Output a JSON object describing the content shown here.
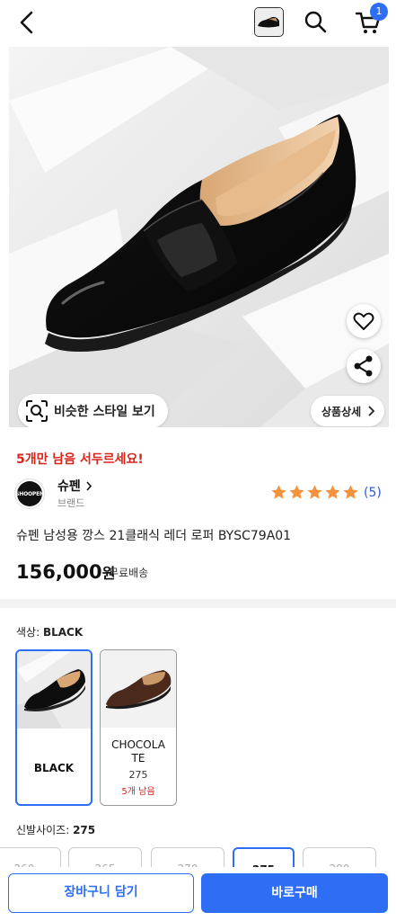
{
  "header": {
    "back_icon": "back-arrow-icon",
    "search_icon": "search-icon",
    "cart_icon": "cart-icon",
    "cart_count": "1"
  },
  "hero": {
    "similar_style_label": "비슷한 스타일 보기",
    "detail_label": "상품상세",
    "favorite_icon": "heart-icon",
    "share_icon": "share-icon"
  },
  "product": {
    "stock_warning": "5개만 남음 서두르세요!",
    "brand_name": "슈펜",
    "brand_caption": "브랜드",
    "brand_logo_text": "SHOOPEN",
    "rating_stars": 5,
    "review_count": "(5)",
    "name": "슈펜 남성용 깡스 21클래식 레더 로퍼 BYSC79A01",
    "price": "156,000",
    "price_unit": "원",
    "shipping": "무료배송"
  },
  "color_option": {
    "label": "색상:",
    "selected": "BLACK",
    "options": [
      {
        "name": "BLACK",
        "size": "",
        "stock": ""
      },
      {
        "name": "CHOCOLATE",
        "name_line1": "CHOCOLA",
        "name_line2": "TE",
        "size": "275",
        "stock": "5개 남음"
      }
    ]
  },
  "size_option": {
    "label": "신발사이즈:",
    "selected": "275",
    "sizes": [
      "260",
      "265",
      "270",
      "275",
      "280"
    ]
  },
  "actions": {
    "add_to_cart": "장바구니 담기",
    "buy_now": "바로구매"
  },
  "colors": {
    "accent": "#2d6ef5",
    "warning": "#d8261c",
    "star": "#f5923e"
  }
}
